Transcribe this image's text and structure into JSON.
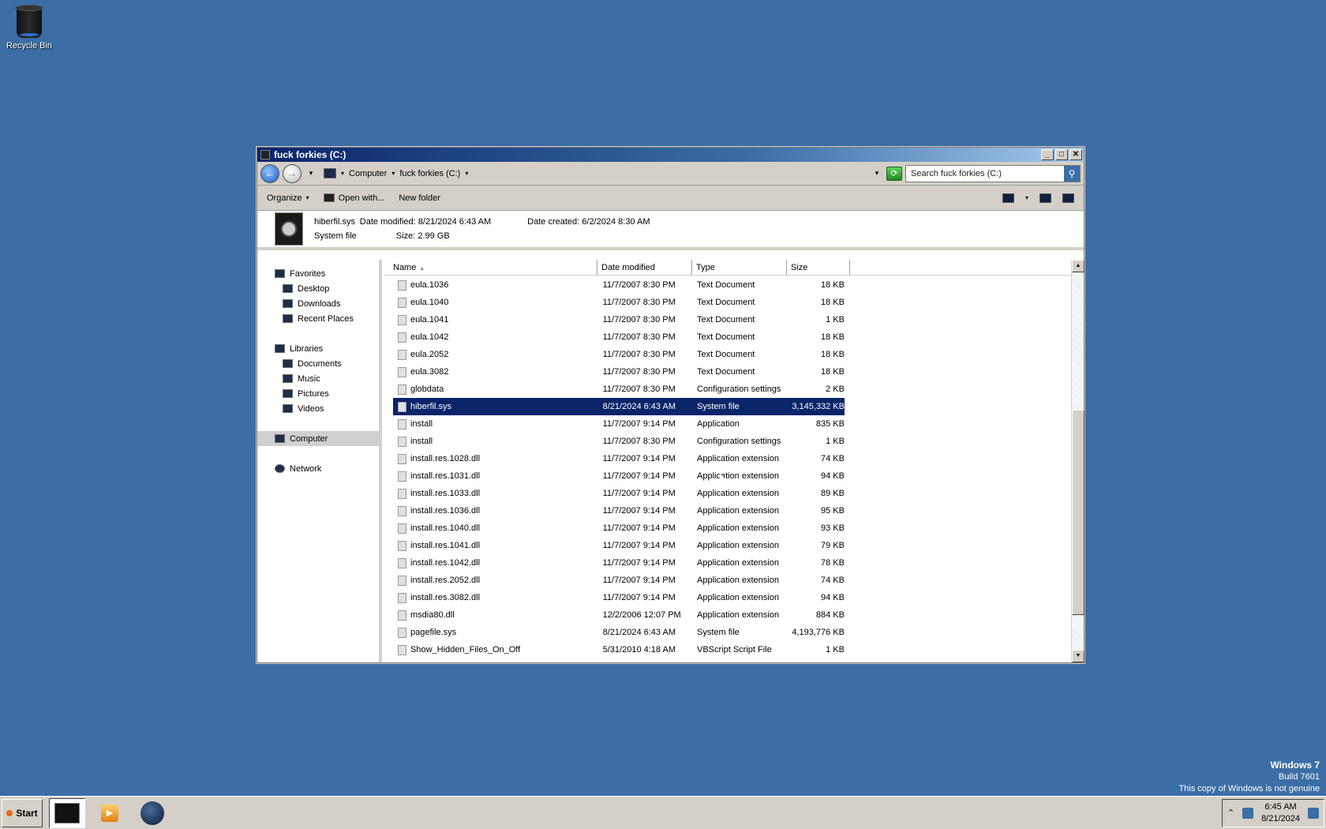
{
  "desktop": {
    "recycle_bin_label": "Recycle Bin"
  },
  "window": {
    "title": "fuck forkies (C:)",
    "controls": {
      "minimize": "_",
      "maximize": "□",
      "close": "✕"
    }
  },
  "address": {
    "back_icon": "back-arrow-icon",
    "forward_icon": "forward-arrow-icon",
    "crumbs": [
      "Computer",
      "fuck forkies (C:)"
    ],
    "search_placeholder": "Search fuck forkies (C:)"
  },
  "toolbar": {
    "organize": "Organize",
    "open_with": "Open with...",
    "new_folder": "New folder"
  },
  "details": {
    "file_name": "hiberfil.sys",
    "date_modified_label": "Date modified:",
    "date_modified": "8/21/2024 6:43 AM",
    "date_created_label": "Date created:",
    "date_created": "6/2/2024 8:30 AM",
    "file_type": "System file",
    "size_label": "Size:",
    "size": "2.99 GB"
  },
  "nav": {
    "favorites": "Favorites",
    "desktop": "Desktop",
    "downloads": "Downloads",
    "recent_places": "Recent Places",
    "libraries": "Libraries",
    "documents": "Documents",
    "music": "Music",
    "pictures": "Pictures",
    "videos": "Videos",
    "computer": "Computer",
    "network": "Network"
  },
  "columns": {
    "name": "Name",
    "date_modified": "Date modified",
    "type": "Type",
    "size": "Size"
  },
  "files": [
    {
      "name": "eula.1036",
      "date": "11/7/2007 8:30 PM",
      "type": "Text Document",
      "size": "18 KB"
    },
    {
      "name": "eula.1040",
      "date": "11/7/2007 8:30 PM",
      "type": "Text Document",
      "size": "18 KB"
    },
    {
      "name": "eula.1041",
      "date": "11/7/2007 8:30 PM",
      "type": "Text Document",
      "size": "1 KB"
    },
    {
      "name": "eula.1042",
      "date": "11/7/2007 8:30 PM",
      "type": "Text Document",
      "size": "18 KB"
    },
    {
      "name": "eula.2052",
      "date": "11/7/2007 8:30 PM",
      "type": "Text Document",
      "size": "18 KB"
    },
    {
      "name": "eula.3082",
      "date": "11/7/2007 8:30 PM",
      "type": "Text Document",
      "size": "18 KB"
    },
    {
      "name": "globdata",
      "date": "11/7/2007 8:30 PM",
      "type": "Configuration settings",
      "size": "2 KB"
    },
    {
      "name": "hiberfil.sys",
      "date": "8/21/2024 6:43 AM",
      "type": "System file",
      "size": "3,145,332 KB"
    },
    {
      "name": "install",
      "date": "11/7/2007 9:14 PM",
      "type": "Application",
      "size": "835 KB"
    },
    {
      "name": "install",
      "date": "11/7/2007 8:30 PM",
      "type": "Configuration settings",
      "size": "1 KB"
    },
    {
      "name": "install.res.1028.dll",
      "date": "11/7/2007 9:14 PM",
      "type": "Application extension",
      "size": "74 KB"
    },
    {
      "name": "install.res.1031.dll",
      "date": "11/7/2007 9:14 PM",
      "type": "Application extension",
      "size": "94 KB"
    },
    {
      "name": "install.res.1033.dll",
      "date": "11/7/2007 9:14 PM",
      "type": "Application extension",
      "size": "89 KB"
    },
    {
      "name": "install.res.1036.dll",
      "date": "11/7/2007 9:14 PM",
      "type": "Application extension",
      "size": "95 KB"
    },
    {
      "name": "install.res.1040.dll",
      "date": "11/7/2007 9:14 PM",
      "type": "Application extension",
      "size": "93 KB"
    },
    {
      "name": "install.res.1041.dll",
      "date": "11/7/2007 9:14 PM",
      "type": "Application extension",
      "size": "79 KB"
    },
    {
      "name": "install.res.1042.dll",
      "date": "11/7/2007 9:14 PM",
      "type": "Application extension",
      "size": "78 KB"
    },
    {
      "name": "install.res.2052.dll",
      "date": "11/7/2007 9:14 PM",
      "type": "Application extension",
      "size": "74 KB"
    },
    {
      "name": "install.res.3082.dll",
      "date": "11/7/2007 9:14 PM",
      "type": "Application extension",
      "size": "94 KB"
    },
    {
      "name": "msdia80.dll",
      "date": "12/2/2006 12:07 PM",
      "type": "Application extension",
      "size": "884 KB"
    },
    {
      "name": "pagefile.sys",
      "date": "8/21/2024 6:43 AM",
      "type": "System file",
      "size": "4,193,776 KB"
    },
    {
      "name": "Show_Hidden_Files_On_Off",
      "date": "5/31/2010 4:18 AM",
      "type": "VBScript Script File",
      "size": "1 KB"
    }
  ],
  "selected_index": 7,
  "watermark": {
    "line1": "Windows 7",
    "line2": "Build 7601",
    "line3": "This copy of Windows is not genuine"
  },
  "taskbar": {
    "start": "Start",
    "time": "6:45 AM",
    "date": "8/21/2024"
  },
  "colors": {
    "desktop": "#3a6ea5",
    "selection": "#0a246a",
    "chrome": "#d4d0c8"
  }
}
